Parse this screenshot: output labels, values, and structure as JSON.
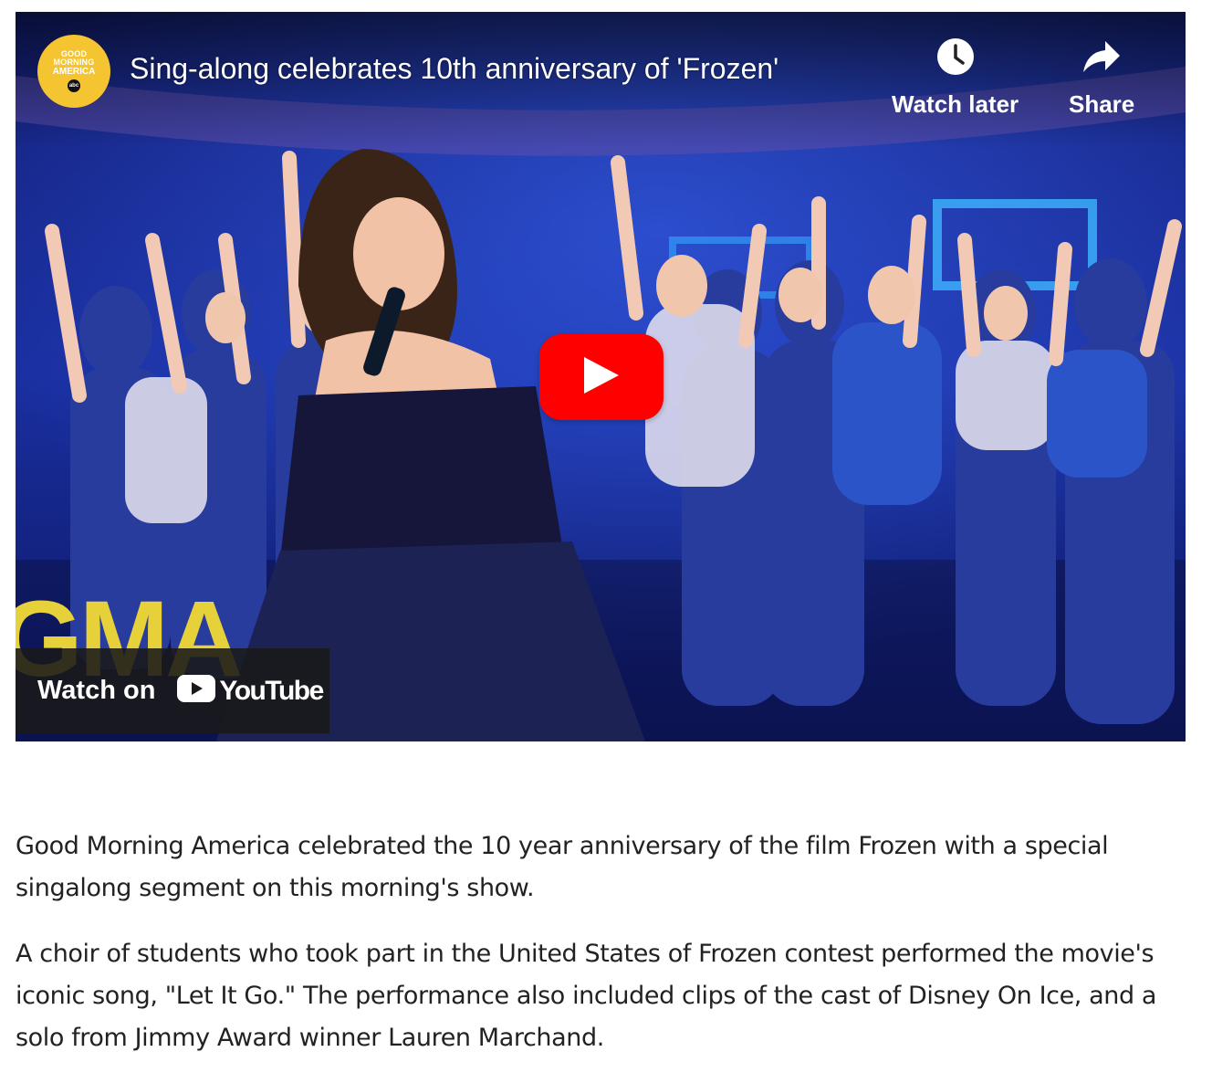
{
  "video": {
    "title": "Sing-along celebrates 10th anniversary of 'Frozen'",
    "channel_logo": {
      "line1": "GOOD",
      "line2": "MORNING",
      "line3": "AMERICA",
      "network": "abc"
    },
    "watch_later_label": "Watch later",
    "share_label": "Share",
    "watermark": "GMA",
    "watch_on_label": "Watch on",
    "youtube_label": "YouTube",
    "icons": [
      "clock-icon",
      "share-arrow-icon",
      "play-icon",
      "youtube-play-icon"
    ],
    "colors": {
      "play_button": "#ff0000",
      "logo": "#f5c431",
      "watermark": "#e7d13a"
    }
  },
  "article": {
    "paragraphs": [
      "Good Morning America celebrated the 10 year anniversary of the film Frozen with a special singalong segment on this morning's show.",
      "A choir of students who took part in the United States of Frozen contest performed the movie's iconic song, \"Let It Go.\" The performance also included clips of the cast of Disney On Ice, and a solo from Jimmy Award winner Lauren Marchand."
    ]
  }
}
